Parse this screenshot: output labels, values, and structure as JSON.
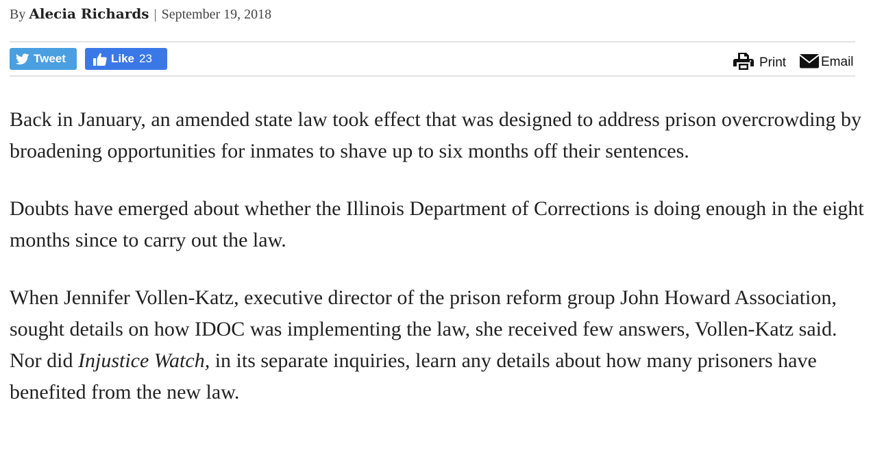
{
  "byline": {
    "prefix": "By",
    "author": "Alecia Richards",
    "separator": "|",
    "date": "September 19, 2018"
  },
  "share": {
    "tweet_label": "Tweet",
    "like_label": "Like",
    "like_count": "23",
    "print_label": "Print",
    "email_label": "Email",
    "tweet_color": "#4a9fe0",
    "like_color": "#3b78e7"
  },
  "article": {
    "p1": "Back in January, an amended state law took effect that was designed to address prison overcrowding by broadening opportunities for inmates to shave up to six months off their sentences.",
    "p2": "Doubts have emerged about whether the Illinois Department of Corrections is doing enough in the eight months since to carry out the law.",
    "p3_before": "When Jennifer Vollen-Katz, executive director of the prison reform group John Howard Association, sought details on how IDOC was implementing the law, she received few answers, Vollen-Katz said. Nor did ",
    "p3_italic": "Injustice Watch,",
    "p3_after": " in its separate inquiries, learn any details about how many prisoners have benefited from the new law."
  },
  "icons": {
    "tweet": "twitter-bird-icon",
    "like": "thumbs-up-icon",
    "print": "printer-icon",
    "email": "envelope-icon"
  }
}
